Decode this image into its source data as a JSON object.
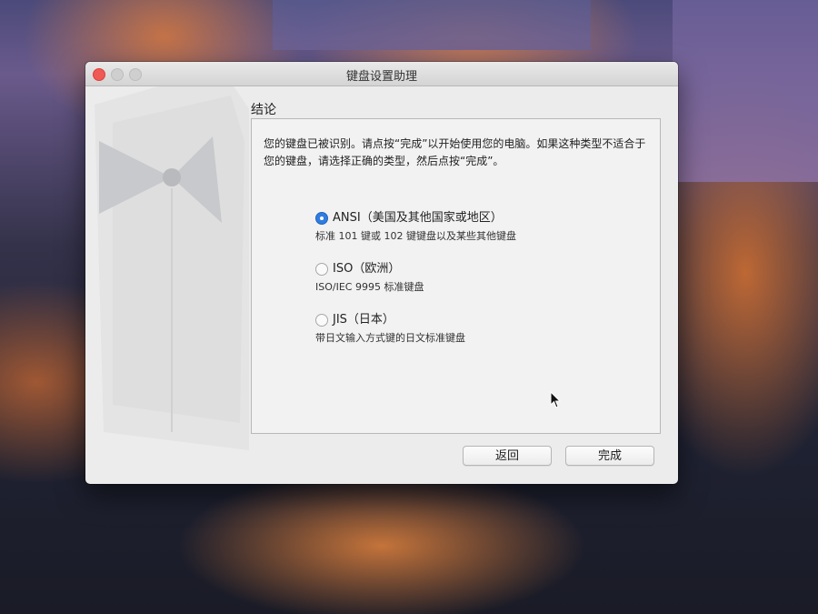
{
  "window": {
    "title": "键盘设置助理"
  },
  "section": {
    "title": "结论"
  },
  "message": "您的键盘已被识别。请点按“完成”以开始使用您的电脑。如果这种类型不适合于您的键盘，请选择正确的类型，然后点按“完成”。",
  "options": [
    {
      "label": "ANSI（美国及其他国家或地区）",
      "description": "标准 101 键或 102 键键盘以及某些其他键盘",
      "selected": true
    },
    {
      "label": "ISO（欧洲）",
      "description": "ISO/IEC 9995 标准键盘",
      "selected": false
    },
    {
      "label": "JIS（日本）",
      "description": "带日文输入方式键的日文标准键盘",
      "selected": false
    }
  ],
  "buttons": {
    "back": "返回",
    "done": "完成"
  },
  "icons": {
    "illustration": "keyboard-setup-bowtie-icon",
    "cursor": "mouse-pointer-icon"
  },
  "colors": {
    "accent": "#2f7de1",
    "close": "#f05a55"
  }
}
